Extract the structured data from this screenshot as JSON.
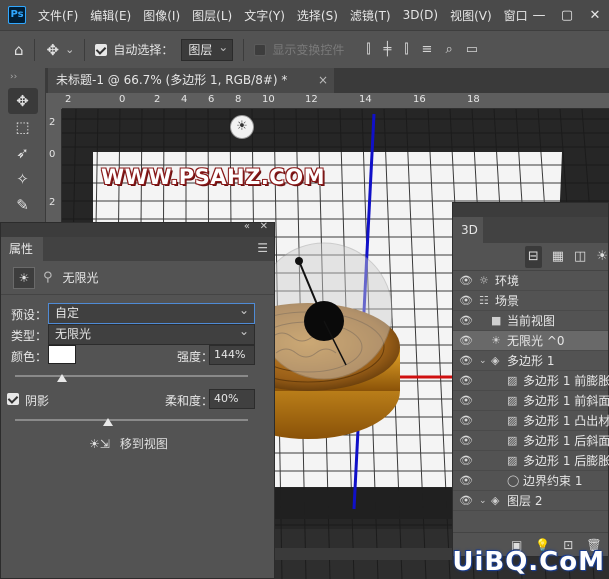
{
  "app": {
    "logo": "Ps"
  },
  "menubar": {
    "items": [
      "文件(F)",
      "编辑(E)",
      "图像(I)",
      "图层(L)",
      "文字(Y)",
      "选择(S)",
      "滤镜(T)",
      "3D(D)",
      "视图(V)",
      "窗口"
    ],
    "window_controls": [
      "—",
      "▢",
      "✕"
    ]
  },
  "options": {
    "home_icon": "home-icon",
    "move_icon": "move-icon",
    "auto_select_label": "自动选择：",
    "auto_select_checked": true,
    "auto_select_target": "图层",
    "show_transform_label": "显示变换控件",
    "show_transform_checked": false
  },
  "document": {
    "tab_title": "未标题-1 @ 66.7% (多边形 1, RGB/8#) *",
    "close": "×",
    "ruler_h_numbers": [
      "2",
      "0",
      "2",
      "4",
      "6",
      "8",
      "10",
      "12",
      "14",
      "16",
      "18"
    ],
    "ruler_v_numbers": [
      "2",
      "0",
      "2"
    ],
    "watermark": "WWW.PSAHZ.COM"
  },
  "properties": {
    "tab": "属性",
    "header_title": "无限光",
    "preset_label": "预设：",
    "preset_value": "自定",
    "type_label": "类型：",
    "type_value": "无限光",
    "color_label": "颜色：",
    "color_value": "#ffffff",
    "intensity_label": "强度：",
    "intensity_value": "144%",
    "intensity_fraction": 0.2,
    "shadow_label": "阴影",
    "shadow_checked": true,
    "softness_label": "柔和度：",
    "softness_value": "40%",
    "softness_fraction": 0.4,
    "move_to_view": "移到视图"
  },
  "panel3d": {
    "tab": "3D",
    "rows": [
      {
        "label": "环境",
        "icon": "environment-icon",
        "level": 0,
        "twisty": "",
        "selected": false
      },
      {
        "label": "场景",
        "icon": "scene-icon",
        "level": 0,
        "twisty": "",
        "selected": false
      },
      {
        "label": "当前视图",
        "icon": "camera-icon",
        "level": 1,
        "twisty": "",
        "selected": false
      },
      {
        "label": "无限光 ^0",
        "icon": "infinite-light-icon",
        "level": 1,
        "twisty": "",
        "selected": true
      },
      {
        "label": "多边形 1",
        "icon": "mesh-icon",
        "level": 1,
        "twisty": "⌄",
        "selected": false
      },
      {
        "label": "多边形 1 前膨胀材质",
        "icon": "material-icon",
        "level": 2,
        "twisty": "",
        "selected": false
      },
      {
        "label": "多边形 1 前斜面材质",
        "icon": "material-icon",
        "level": 2,
        "twisty": "",
        "selected": false
      },
      {
        "label": "多边形 1 凸出材质",
        "icon": "material-icon",
        "level": 2,
        "twisty": "",
        "selected": false
      },
      {
        "label": "多边形 1 后斜面材质",
        "icon": "material-icon",
        "level": 2,
        "twisty": "",
        "selected": false
      },
      {
        "label": "多边形 1 后膨胀材质",
        "icon": "material-icon",
        "level": 2,
        "twisty": "",
        "selected": false
      },
      {
        "label": "边界约束 1",
        "icon": "constraint-icon",
        "level": 2,
        "twisty": "",
        "selected": false
      },
      {
        "label": "图层 2",
        "icon": "mesh-icon",
        "level": 1,
        "twisty": "⌄",
        "selected": false
      }
    ]
  },
  "site_mark": "UiBQ.CoM"
}
